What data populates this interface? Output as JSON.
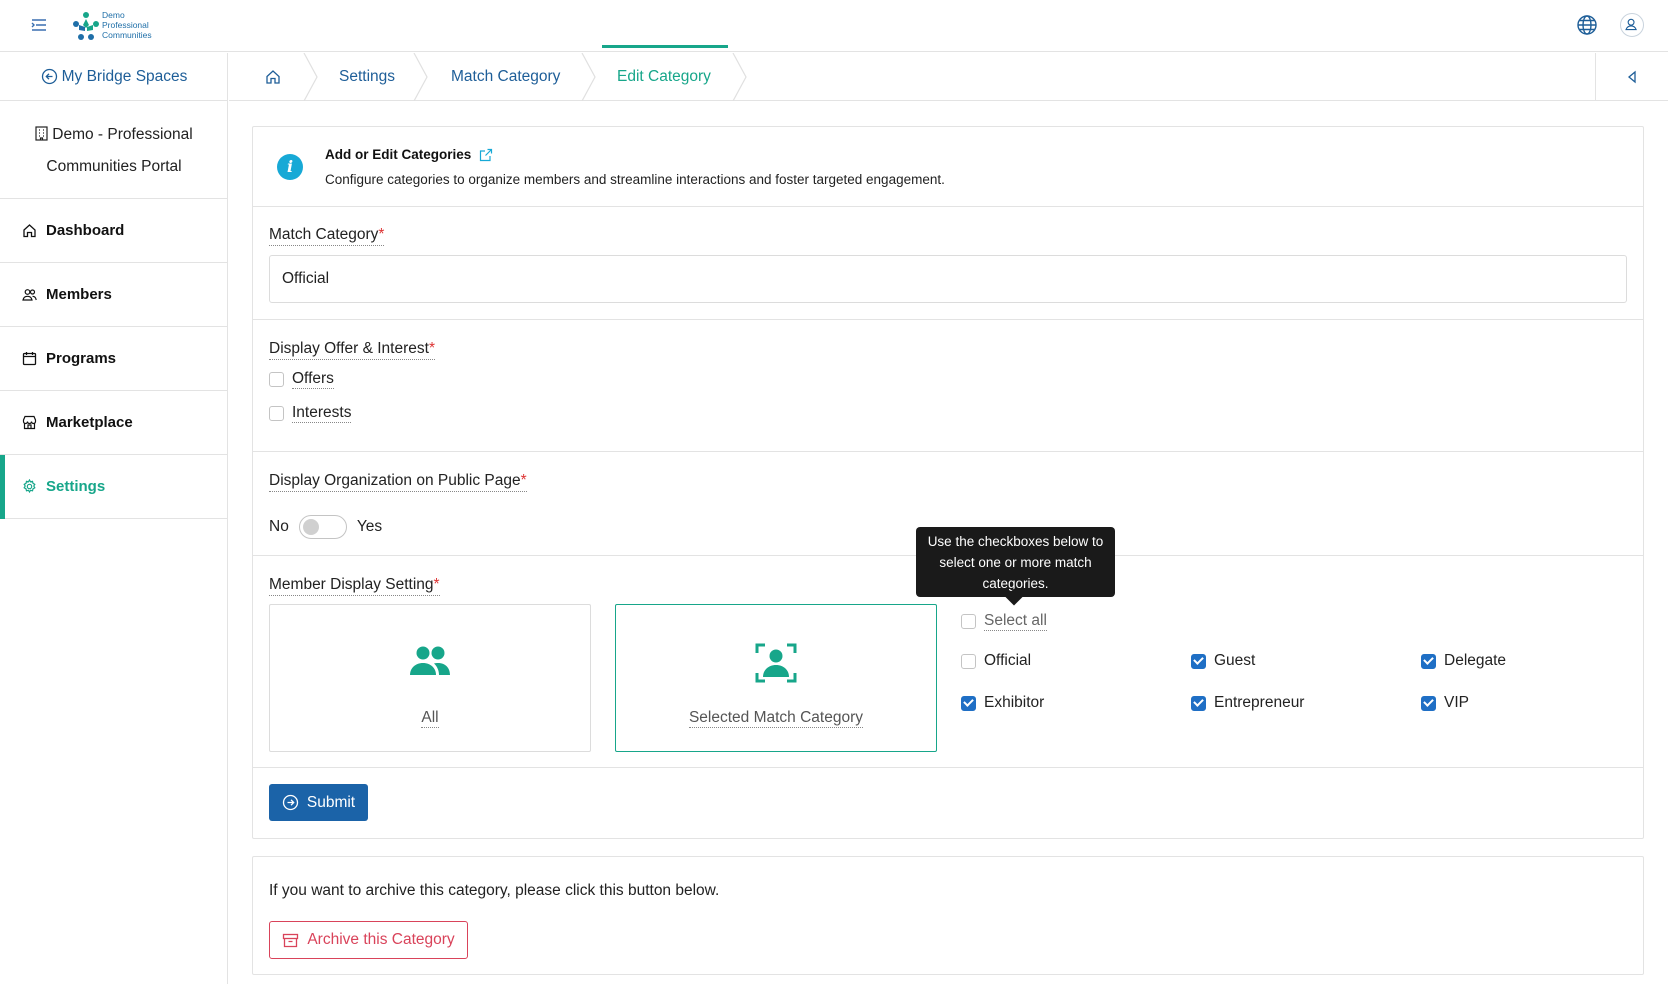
{
  "app": {
    "logo_lines": [
      "Demo",
      "Professional",
      "Communities"
    ],
    "icons": {
      "menu": "menu-icon",
      "language": "globe-icon",
      "account": "user-icon"
    }
  },
  "sidebar": {
    "back_label": "My Bridge Spaces",
    "org_line1": "Demo - Professional",
    "org_line2": "Communities Portal",
    "items": [
      {
        "label": "Dashboard",
        "icon": "home-icon"
      },
      {
        "label": "Members",
        "icon": "members-icon"
      },
      {
        "label": "Programs",
        "icon": "calendar-icon"
      },
      {
        "label": "Marketplace",
        "icon": "store-icon"
      },
      {
        "label": "Settings",
        "icon": "gear-icon",
        "active": true
      }
    ]
  },
  "breadcrumb": {
    "items": [
      "Settings",
      "Match Category",
      "Edit Category"
    ],
    "active_index": 2
  },
  "info": {
    "title": "Add or Edit Categories",
    "description": "Configure categories to organize members and streamline interactions and foster targeted engagement."
  },
  "form": {
    "match_category_label": "Match Category",
    "match_category_value": "Official",
    "offer_interest_label": "Display Offer & Interest",
    "offer_label": "Offers",
    "interest_label": "Interests",
    "org_public_label": "Display Organization on Public Page",
    "toggle_no": "No",
    "toggle_yes": "Yes",
    "member_display_label": "Member Display Setting",
    "option_all": "All",
    "option_selected": "Selected Match Category",
    "tooltip": "Use the checkboxes below to select one or more match categories.",
    "select_all": "Select all",
    "categories": [
      {
        "label": "Official",
        "checked": false
      },
      {
        "label": "Guest",
        "checked": true
      },
      {
        "label": "Delegate",
        "checked": true
      },
      {
        "label": "Exhibitor",
        "checked": true
      },
      {
        "label": "Entrepreneur",
        "checked": true
      },
      {
        "label": "VIP",
        "checked": true
      }
    ],
    "submit_label": "Submit",
    "required_mark": "*"
  },
  "archive": {
    "text": "If you want to archive this category, please click this button below.",
    "button_label": "Archive this Category"
  },
  "colors": {
    "accent": "#17a68a",
    "primary": "#1b63a8",
    "danger": "#d9435a",
    "info": "#17a9d6"
  }
}
